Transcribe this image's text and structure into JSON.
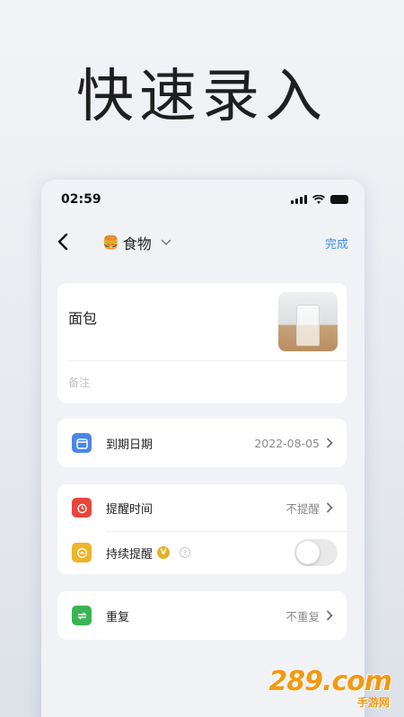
{
  "headline": "快速录入",
  "status": {
    "time": "02:59"
  },
  "nav": {
    "emoji": "🍔",
    "title": "食物",
    "done": "完成"
  },
  "item": {
    "name": "面包",
    "note_placeholder": "备注"
  },
  "rows": {
    "expiry": {
      "label": "到期日期",
      "value": "2022-08-05"
    },
    "reminder": {
      "label": "提醒时间",
      "value": "不提醒"
    },
    "persistent": {
      "label": "持续提醒",
      "vip_mark": "V",
      "help": "?"
    },
    "repeat": {
      "label": "重复",
      "value": "不重复"
    }
  },
  "colors": {
    "accent": "#3d8de8",
    "calendar": "#4a86e8",
    "alarm": "#e8453c",
    "persistent": "#f0b429",
    "repeat": "#3bb454"
  },
  "icons": [
    "back-arrow-icon",
    "burger-icon",
    "chevron-down-icon",
    "calendar-icon",
    "alarm-icon",
    "persistent-alarm-icon",
    "repeat-icon",
    "chevron-right-icon"
  ],
  "watermark": {
    "main": "289.com",
    "sub": "手游网"
  }
}
